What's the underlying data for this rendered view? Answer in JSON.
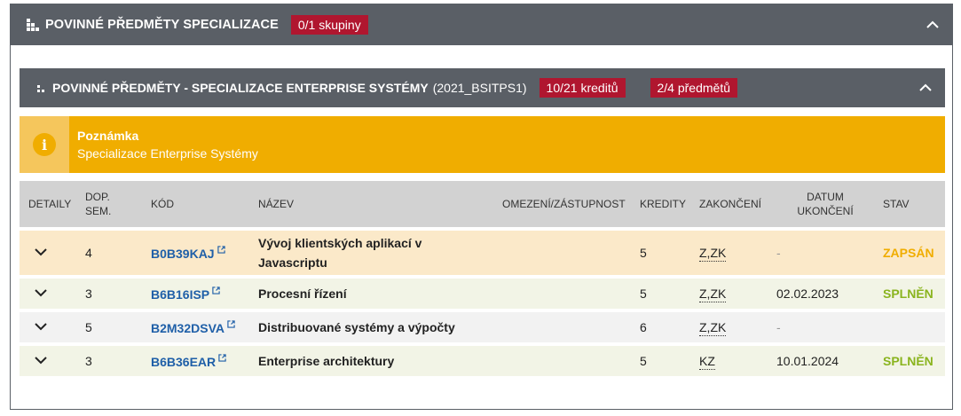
{
  "outer": {
    "title": "POVINNÉ PŘEDMĚTY SPECIALIZACE",
    "badge": "0/1 skupiny"
  },
  "inner": {
    "title": "POVINNÉ PŘEDMĚTY - SPECIALIZACE ENTERPRISE SYSTÉMY",
    "code": "(2021_BSITPS1)",
    "credits_badge": "10/21 kreditů",
    "subjects_badge": "2/4 předmětů"
  },
  "note": {
    "title": "Poznámka",
    "text": "Specializace Enterprise Systémy",
    "icon": "info-icon"
  },
  "table": {
    "headers": {
      "detaily": "DETAILY",
      "dop1": "DOP.",
      "dop2": "SEM.",
      "kod": "KÓD",
      "nazev": "NÁZEV",
      "omezeni": "OMEZENÍ/ZÁSTUPNOST",
      "kredity": "KREDITY",
      "zakonceni": "ZAKONČENÍ",
      "datum1": "DATUM",
      "datum2": "UKONČENÍ",
      "stav": "STAV"
    },
    "rows": [
      {
        "sem": "4",
        "code": "B0B39KAJ",
        "name_line1": "Vývoj klientských aplikací v",
        "name_line2": "Javascriptu",
        "omezeni": "",
        "credits": "5",
        "zak": "Z,ZK",
        "date": "-",
        "status": "ZAPSÁN"
      },
      {
        "sem": "3",
        "code": "B6B16ISP",
        "name_line1": "Procesní řízení",
        "name_line2": "",
        "omezeni": "",
        "credits": "5",
        "zak": "Z,ZK",
        "date": "02.02.2023",
        "status": "SPLNĚN"
      },
      {
        "sem": "5",
        "code": "B2M32DSVA",
        "name_line1": "Distribuované systémy a výpočty",
        "name_line2": "",
        "omezeni": "",
        "credits": "6",
        "zak": "Z,ZK",
        "date": "-",
        "status": ""
      },
      {
        "sem": "3",
        "code": "B6B36EAR",
        "name_line1": "Enterprise architektury",
        "name_line2": "",
        "omezeni": "",
        "credits": "5",
        "zak": "KZ",
        "date": "10.01.2024",
        "status": "SPLNĚN"
      }
    ]
  },
  "colors": {
    "header_bg": "#5a5f66",
    "badge_bg": "#b0162f",
    "note_bg": "#f0ad00",
    "link": "#1f5fa8",
    "status_enrolled": "#f0ad00",
    "status_passed": "#8ab41e"
  }
}
